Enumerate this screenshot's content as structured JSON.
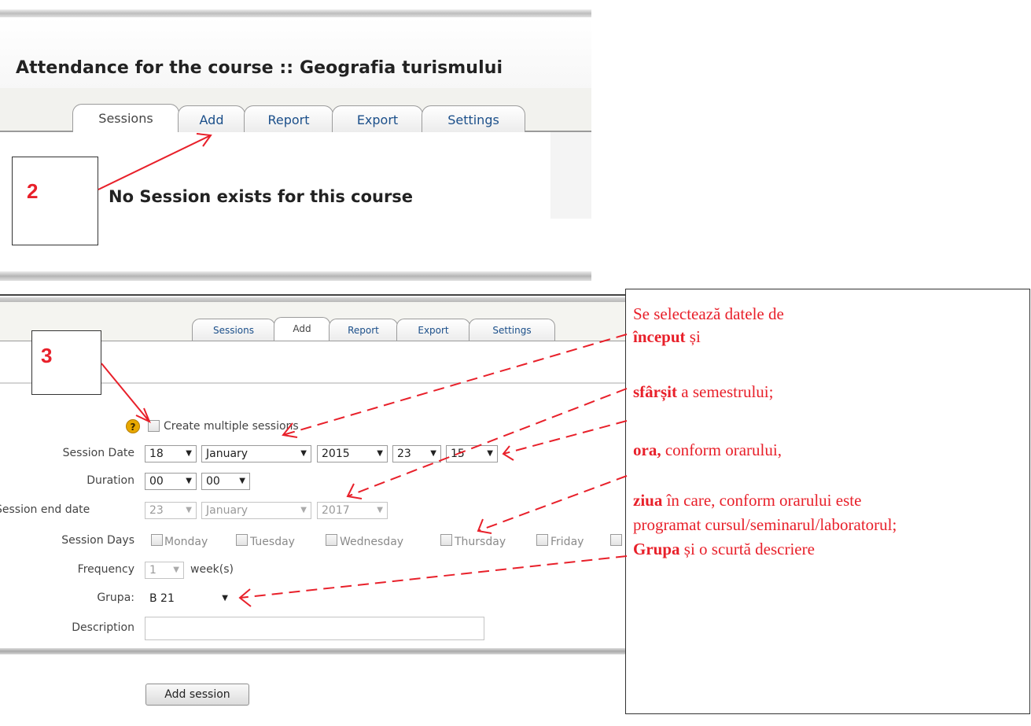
{
  "top": {
    "course_title": "Attendance for the course :: Geografia turismului",
    "tabs": [
      "Sessions",
      "Add",
      "Report",
      "Export",
      "Settings"
    ],
    "active_tab": "Sessions",
    "empty_message": "No Session exists for this course",
    "step_number": "2"
  },
  "form": {
    "tabs": [
      "Sessions",
      "Add",
      "Report",
      "Export",
      "Settings"
    ],
    "active_tab": "Add",
    "step_number": "3",
    "create_multiple_label": "Create multiple sessions",
    "session_date_label": "Session Date",
    "session_date": {
      "day": "18",
      "month": "January",
      "year": "2015",
      "hour": "23",
      "minute": "15"
    },
    "duration_label": "Duration",
    "duration": {
      "hours": "00",
      "minutes": "00"
    },
    "end_date_label": "Session end date",
    "end_date": {
      "day": "23",
      "month": "January",
      "year": "2017"
    },
    "session_days_label": "Session Days",
    "days": [
      "Monday",
      "Tuesday",
      "Wednesday",
      "Thursday",
      "Friday"
    ],
    "frequency_label": "Frequency",
    "frequency_value": "1",
    "frequency_unit": "week(s)",
    "group_label": "Grupa:",
    "group_value": "B 21",
    "description_label": "Description",
    "description_value": "",
    "submit_label": "Add session"
  },
  "annotation": {
    "line1": "Se selectează datele de",
    "line2_bold": "început",
    "line2_rest": " și",
    "line3_bold": "sfârșit",
    "line3_rest": " a semestrului;",
    "line4_bold": "ora,",
    "line4_rest": " conform orarului,",
    "line5_bold": "ziua",
    "line5_rest": " în care, conform orarului este",
    "line6": "programat cursul/seminarul/laboratorul;",
    "line7_bold": "Grupa",
    "line7_rest": " și o scurtă descriere"
  },
  "colors": {
    "annotation_red": "#e8202a",
    "tab_link": "#1b4f8a",
    "help_icon": "#e8a800"
  }
}
